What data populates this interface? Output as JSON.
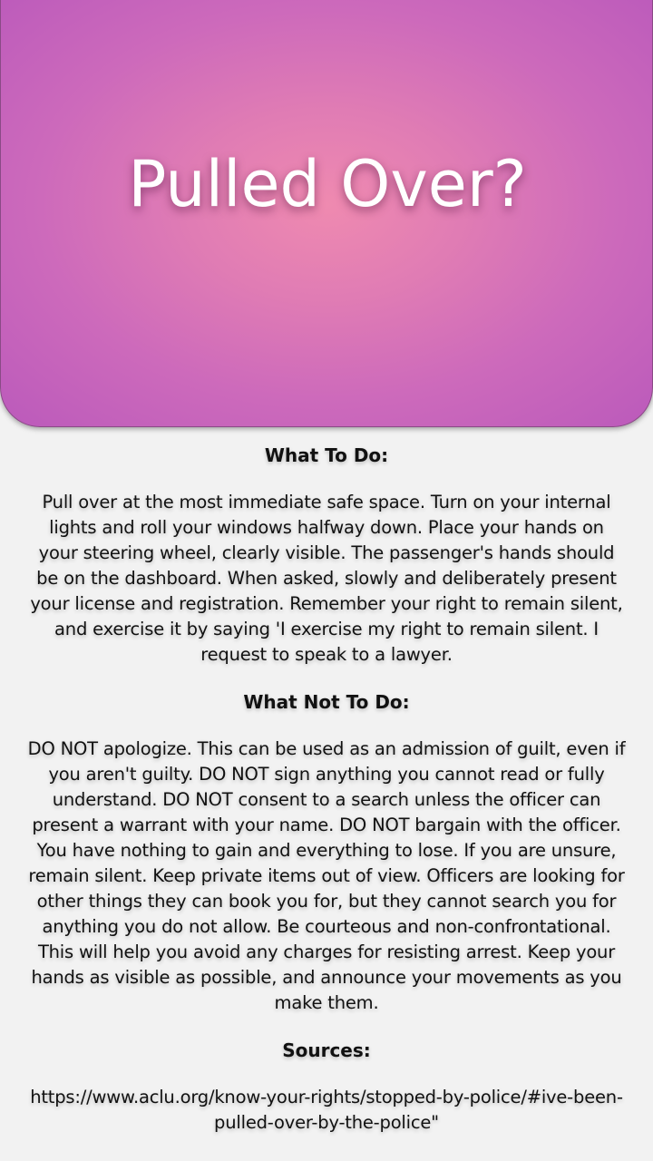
{
  "header": {
    "title": "Pulled Over?"
  },
  "sections": [
    {
      "heading": "What To Do:",
      "body": "Pull over at the most immediate safe space. Turn on your internal lights and roll your windows halfway down. Place your hands on your steering wheel, clearly visible. The passenger's hands should be on the dashboard. When asked, slowly and deliberately present your license and registration. Remember your right to remain silent, and exercise it by saying 'I exercise my right to remain silent. I request to speak to a lawyer."
    },
    {
      "heading": "What Not To Do:",
      "body": "DO NOT apologize. This can be used as an admission of guilt, even if you aren't guilty. DO NOT sign anything you cannot read or fully understand. DO NOT consent to a search unless the officer can present a warrant with your name. DO NOT bargain with the officer. You have nothing to gain and everything to lose. If you are unsure, remain silent. Keep private items out of view. Officers are looking for other things they can book you for, but they cannot search you for anything you do not allow. Be courteous and non-confrontational. This will help you avoid any charges for resisting arrest. Keep your hands as visible as possible, and announce your movements as you make them."
    },
    {
      "heading": "Sources:",
      "body": "https://www.aclu.org/know-your-rights/stopped-by-police/#ive-been-pulled-over-by-the-police\""
    }
  ],
  "colors": {
    "hero_center": "#ef8ab0",
    "hero_edge": "#bb5abb",
    "background": "#f2f2f2",
    "text": "#111111"
  }
}
